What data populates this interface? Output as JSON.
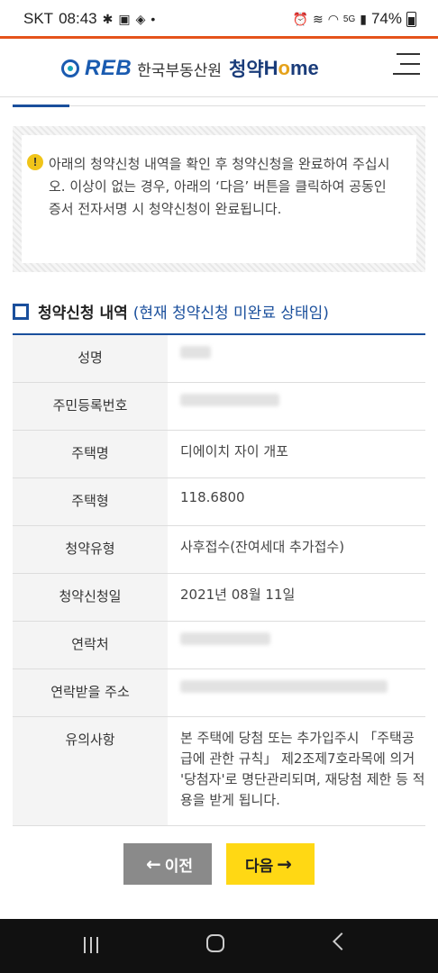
{
  "status_bar": {
    "carrier": "SKT",
    "time": "08:43",
    "battery": "74%",
    "network": "5G"
  },
  "header": {
    "logo_reb": "REB",
    "logo_agency": "한국부동산원",
    "logo_cheongyak": "청약",
    "logo_home_h": "H",
    "logo_home_o": "o",
    "logo_home_me": "me"
  },
  "notice": {
    "icon": "!",
    "text": "아래의 청약신청 내역을 확인 후 청약신청을 완료하여 주십시오. 이상이 없는 경우, 아래의 ‘다음’ 버튼을 클릭하여 공동인증서 전자서명 시 청약신청이 완료됩니다."
  },
  "section": {
    "title": "청약신청 내역",
    "subtitle": "(현재 청약신청 미완료 상태임)"
  },
  "table": {
    "rows": [
      {
        "label": "성명",
        "value": ""
      },
      {
        "label": "주민등록번호",
        "value": ""
      },
      {
        "label": "주택명",
        "value": "디에이치 자이 개포"
      },
      {
        "label": "주택형",
        "value": "118.6800"
      },
      {
        "label": "청약유형",
        "value": "사후접수(잔여세대 추가접수)"
      },
      {
        "label": "청약신청일",
        "value": "2021년 08월 11일"
      },
      {
        "label": "연락처",
        "value": ""
      },
      {
        "label": "연락받을 주소",
        "value": ""
      },
      {
        "label": "유의사항",
        "value": "본 주택에 당첨 또는 추가입주시 「주택공급에 관한 규칙」 제2조제7호라목에 의거 '당첨자'로 명단관리되며, 재당첨 제한 등 적용을 받게 됩니다."
      }
    ]
  },
  "buttons": {
    "prev_label": "이전",
    "next_label": "다음"
  }
}
